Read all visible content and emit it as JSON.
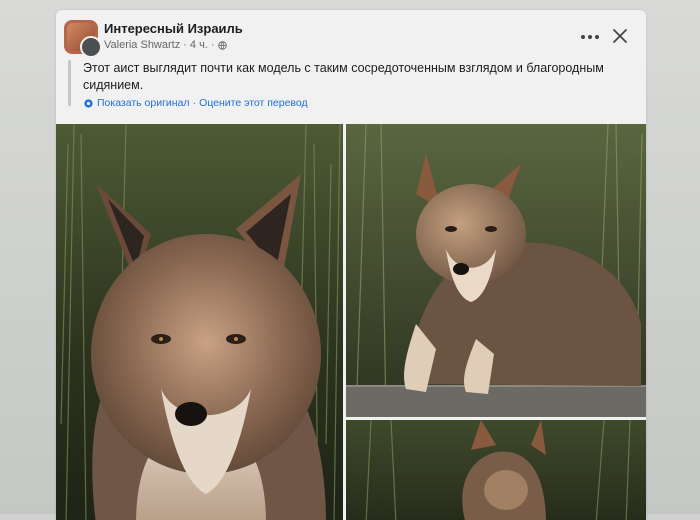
{
  "post": {
    "group_name": "Интересный Израиль",
    "author": "Valeria Shwartz",
    "time": "4 ч.",
    "dot": "·",
    "text": "Этот аист выглядит почти как модель с таким сосредоточенным взглядом и благородным сидянием.",
    "show_original": "Показать оригинал",
    "separator": "·",
    "rate_translation": "Оцените этот перевод"
  },
  "icons": {
    "more": "more-dots-icon",
    "close": "close-icon",
    "audience": "globe-icon",
    "translate": "translate-gear-icon"
  },
  "colors": {
    "link": "#216fdb",
    "text": "#1c1e21",
    "meta": "#65676b",
    "card": "#f0f1f0"
  }
}
